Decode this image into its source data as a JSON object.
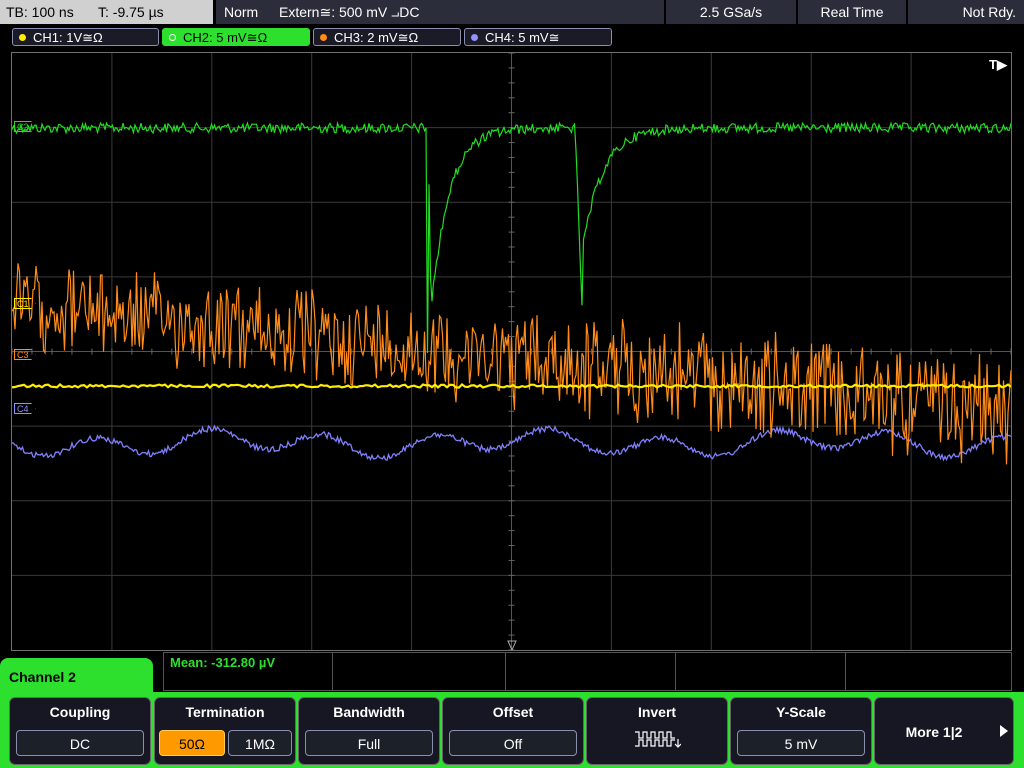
{
  "status": {
    "timebase": "TB: 100 ns",
    "trigger_time": "T: -9.75 µs",
    "trigger_mode": "Norm",
    "trigger_source": "Extern≅: 500 mV ⨼DC",
    "sample_rate": "2.5 GSa/s",
    "acq_mode": "Real Time",
    "acq_state": "Not Rdy."
  },
  "channels": [
    {
      "id": "CH1",
      "label": "CH1: 1V≅Ω",
      "color": "#ffee00",
      "marker": "C1"
    },
    {
      "id": "CH2",
      "label": "CH2: 5 mV≅Ω",
      "color": "#2ee02e",
      "marker": "C2"
    },
    {
      "id": "CH3",
      "label": "CH3: 2 mV≅Ω",
      "color": "#ff8c1a",
      "marker": "C3"
    },
    {
      "id": "CH4",
      "label": "CH4: 5 mV≅",
      "color": "#9090ff",
      "marker": "C4"
    }
  ],
  "trigger_marker": "T▶",
  "measurement": {
    "text": "Mean: -312.80 µV"
  },
  "menu": {
    "title": "Channel 2",
    "coupling": {
      "label": "Coupling",
      "value": "DC"
    },
    "termination": {
      "label": "Termination",
      "options": [
        "50Ω",
        "1MΩ"
      ],
      "selected": "50Ω"
    },
    "bandwidth": {
      "label": "Bandwidth",
      "value": "Full"
    },
    "offset": {
      "label": "Offset",
      "value": "Off"
    },
    "invert": {
      "label": "Invert",
      "icon": "invert-waveform-icon"
    },
    "yscale": {
      "label": "Y-Scale",
      "value": "5 mV"
    },
    "more": {
      "label": "More 1|2",
      "icon": "arrow-right-icon"
    }
  }
}
